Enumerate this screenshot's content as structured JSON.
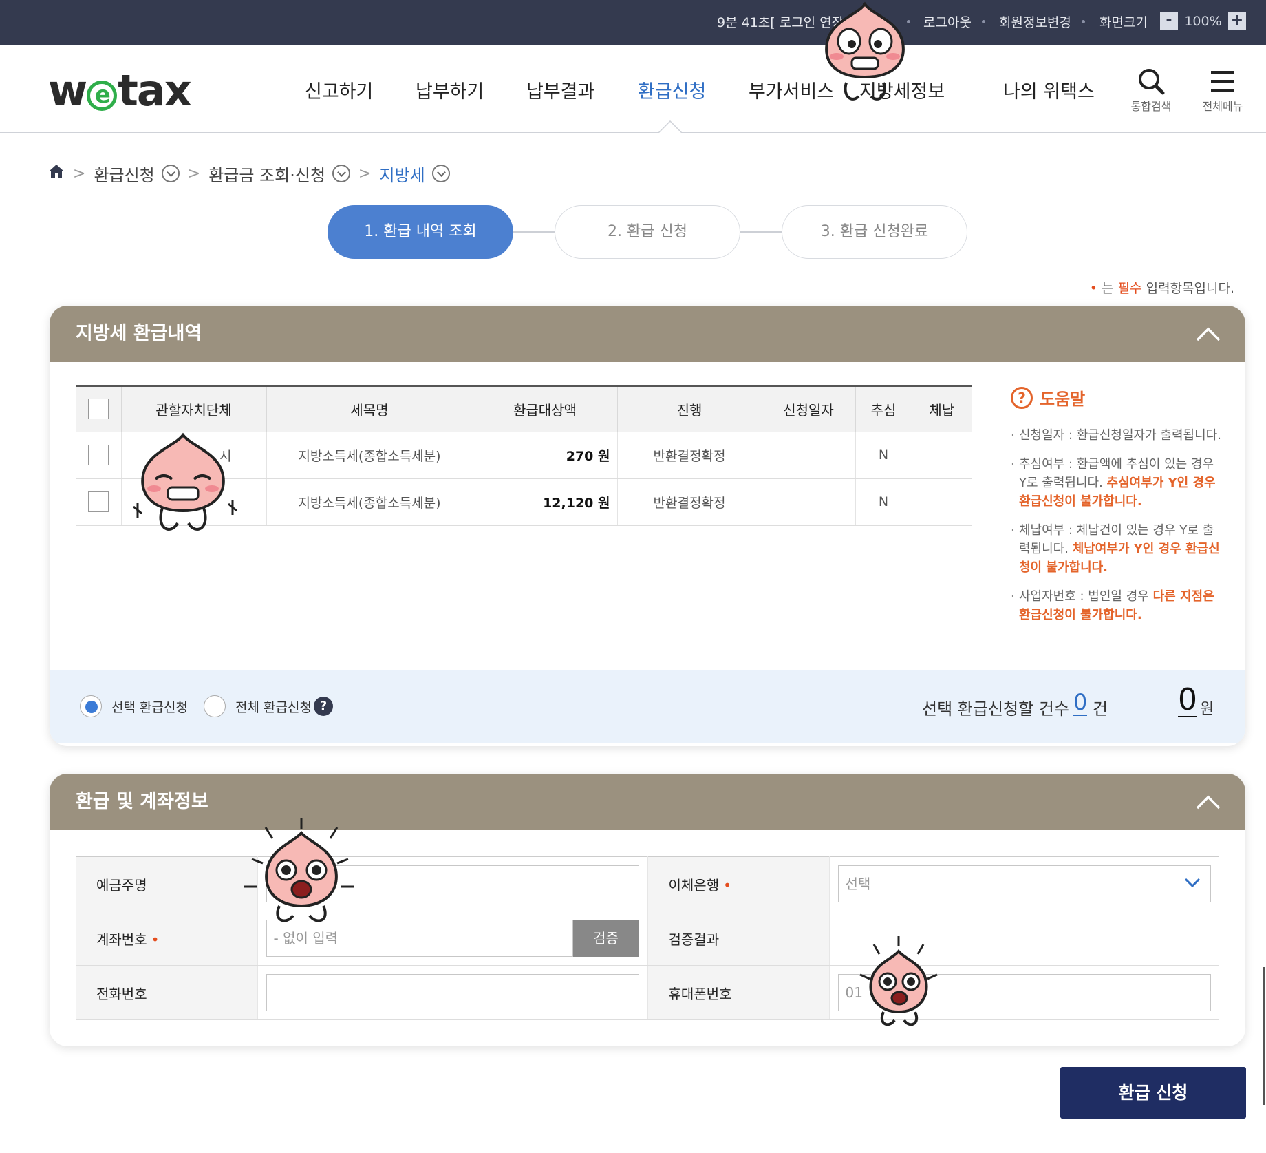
{
  "topbar": {
    "session": "9분 41초[ 로그인 연장",
    "logout": "로그아웃",
    "member_edit": "회원정보변경",
    "screen_size": "화면크기",
    "zoom_minus": "-",
    "zoom_value": "100%",
    "zoom_plus": "+"
  },
  "header": {
    "logo": "wetax",
    "nav": [
      "신고하기",
      "납부하기",
      "납부결과",
      "환급신청",
      "부가서비스",
      "지방세정보",
      "나의 위택스"
    ],
    "search_label": "통합검색",
    "menu_label": "전체메뉴"
  },
  "breadcrumb": [
    "환급신청",
    "환급금 조회·신청",
    "지방세"
  ],
  "steps": [
    "1. 환급 내역 조회",
    "2. 환급 신청",
    "3. 환급 신청완료"
  ],
  "required_note": {
    "prefix": "는 ",
    "emph": "필수",
    "suffix": " 입력항목입니다."
  },
  "refund_panel": {
    "title": "지방세 환급내역",
    "columns": [
      "관할자치단체",
      "세목명",
      "환급대상액",
      "진행",
      "신청일자",
      "추심",
      "체납"
    ],
    "rows": [
      {
        "region": "시",
        "tax": "지방소득세(종합소득세분)",
        "amount": "270 원",
        "status": "반환결정확정",
        "date": "",
        "collect": "N",
        "arrears": ""
      },
      {
        "region": "",
        "tax": "지방소득세(종합소득세분)",
        "amount": "12,120 원",
        "status": "반환결정확정",
        "date": "",
        "collect": "N",
        "arrears": ""
      }
    ],
    "help": {
      "title": "도움말",
      "items": [
        {
          "text": "신청일자 : 환급신청일자가 출력됩니다.",
          "emph": ""
        },
        {
          "text": "추심여부 : 환급액에 추심이 있는 경우 Y로 출력됩니다. ",
          "emph": "추심여부가 Y인 경우 환급신청이 불가합니다."
        },
        {
          "text": "체납여부 : 체납건이 있는 경우 Y로 출력됩니다. ",
          "emph": "체납여부가 Y인 경우 환급신청이 불가합니다."
        },
        {
          "text": "사업자번호 : 법인일 경우 ",
          "emph": "다른 지점은 환급신청이 불가합니다."
        }
      ]
    },
    "select_option": "선택 환급신청",
    "all_option": "전체 환급신청",
    "count_label": "선택 환급신청할 건수",
    "count_value": "0",
    "count_unit": "건",
    "amount_value": "0",
    "amount_unit": "원"
  },
  "account_panel": {
    "title": "환급 및 계좌정보",
    "depositor_label": "예금주명",
    "bank_label": "이체은행",
    "bank_value": "선택",
    "account_label": "계좌번호",
    "account_placeholder": "- 없이 입력",
    "verify_button": "검증",
    "verify_result_label": "검증결과",
    "phone_label": "전화번호",
    "mobile_label": "휴대폰번호",
    "mobile_value": "01"
  },
  "submit_label": "환급 신청",
  "colors": {
    "topbar": "#343a4f",
    "panel_head": "#9b917f",
    "accent": "#2f6ec4",
    "step_active": "#4c80d0",
    "help": "#e4642b",
    "submit": "#1f2d63"
  }
}
